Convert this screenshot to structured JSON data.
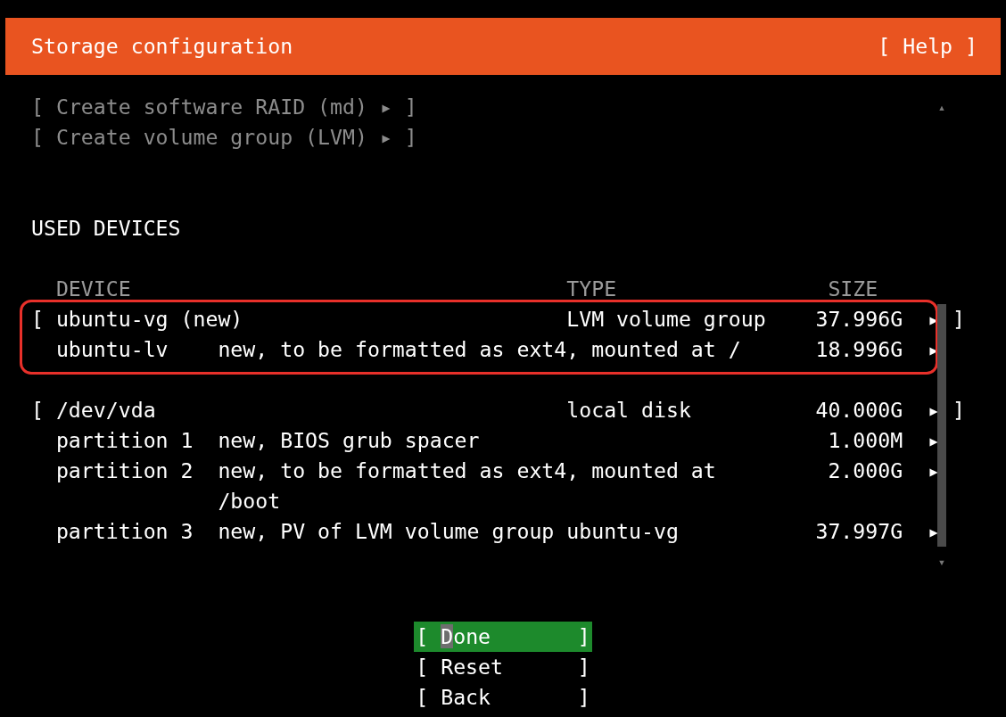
{
  "header": {
    "title": "Storage configuration",
    "help_button": "[ Help ]"
  },
  "actions": [
    {
      "label": "[ Create software RAID (md) ▸ ]",
      "disabled": true
    },
    {
      "label": "[ Create volume group (LVM) ▸ ]",
      "disabled": true
    }
  ],
  "scroll": {
    "up": "▴",
    "down": "▾"
  },
  "section_title": "USED DEVICES",
  "table": {
    "columns": [
      "DEVICE",
      "TYPE",
      "SIZE"
    ],
    "groups": [
      {
        "highlighted": true,
        "rows": [
          {
            "kind": "device",
            "open": "[",
            "name": "ubuntu-vg (new)",
            "type": "LVM volume group",
            "size": "37.996G",
            "arrow": "▸",
            "close": "]"
          },
          {
            "kind": "partition",
            "name": "ubuntu-lv",
            "description": "new, to be formatted as ext4, mounted at /",
            "size": "18.996G",
            "arrow": "▸"
          }
        ]
      },
      {
        "highlighted": false,
        "rows": [
          {
            "kind": "device",
            "open": "[",
            "name": "/dev/vda",
            "type": "local disk",
            "size": "40.000G",
            "arrow": "▸",
            "close": "]"
          },
          {
            "kind": "partition",
            "name": "partition 1",
            "description": "new, BIOS grub spacer",
            "size": "1.000M",
            "arrow": "▸"
          },
          {
            "kind": "partition",
            "name": "partition 2",
            "description": "new, to be formatted as ext4, mounted at /boot",
            "size": "2.000G",
            "arrow": "▸"
          },
          {
            "kind": "partition",
            "name": "partition 3",
            "description": "new, PV of LVM volume group ubuntu-vg",
            "size": "37.997G",
            "arrow": "▸"
          }
        ]
      }
    ]
  },
  "buttons": [
    {
      "open": "[",
      "label": "Done",
      "close": "]",
      "selected": true
    },
    {
      "open": "[",
      "label": "Reset",
      "close": "]",
      "selected": false
    },
    {
      "open": "[",
      "label": "Back",
      "close": "]",
      "selected": false
    }
  ]
}
